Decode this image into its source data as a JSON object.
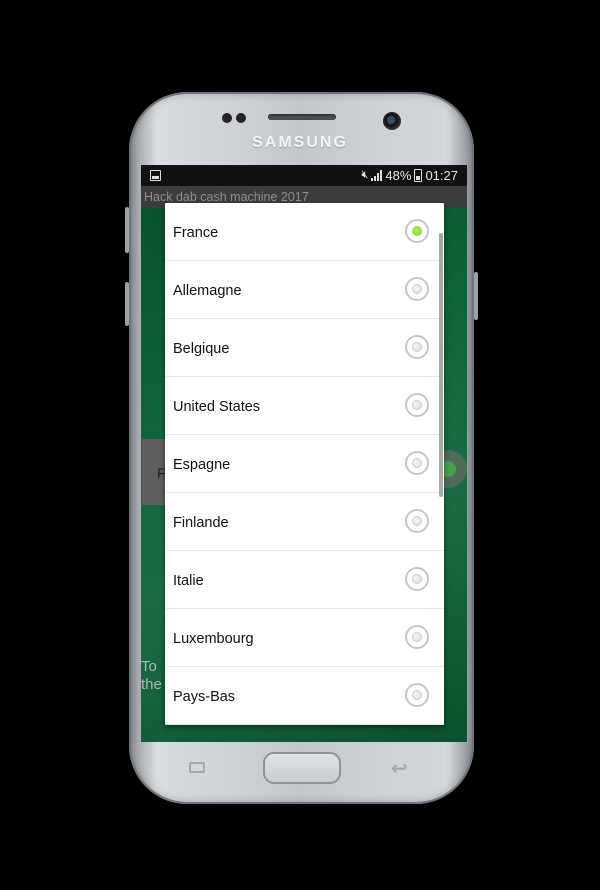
{
  "device": {
    "brand": "SAMSUNG"
  },
  "status_bar": {
    "battery": "48%",
    "time": "01:27"
  },
  "app": {
    "title": "Hack dab cash machine 2017",
    "background_button_label": "F",
    "background_text": "To\nthe"
  },
  "dialog": {
    "options": [
      {
        "label": "France",
        "checked": true
      },
      {
        "label": "Allemagne",
        "checked": false
      },
      {
        "label": "Belgique",
        "checked": false
      },
      {
        "label": "United States",
        "checked": false
      },
      {
        "label": "Espagne",
        "checked": false
      },
      {
        "label": "Finlande",
        "checked": false
      },
      {
        "label": "Italie",
        "checked": false
      },
      {
        "label": "Luxembourg",
        "checked": false
      },
      {
        "label": "Pays-Bas",
        "checked": false
      }
    ]
  },
  "colors": {
    "app_background": "#0d6338",
    "radio_selected": "#7fcd2e",
    "status_bar": "#111111"
  },
  "icons": {
    "status": [
      "gallery-icon",
      "mute-icon",
      "signal-icon",
      "battery-icon"
    ],
    "nav": [
      "recents-icon",
      "home-button",
      "back-icon"
    ]
  }
}
